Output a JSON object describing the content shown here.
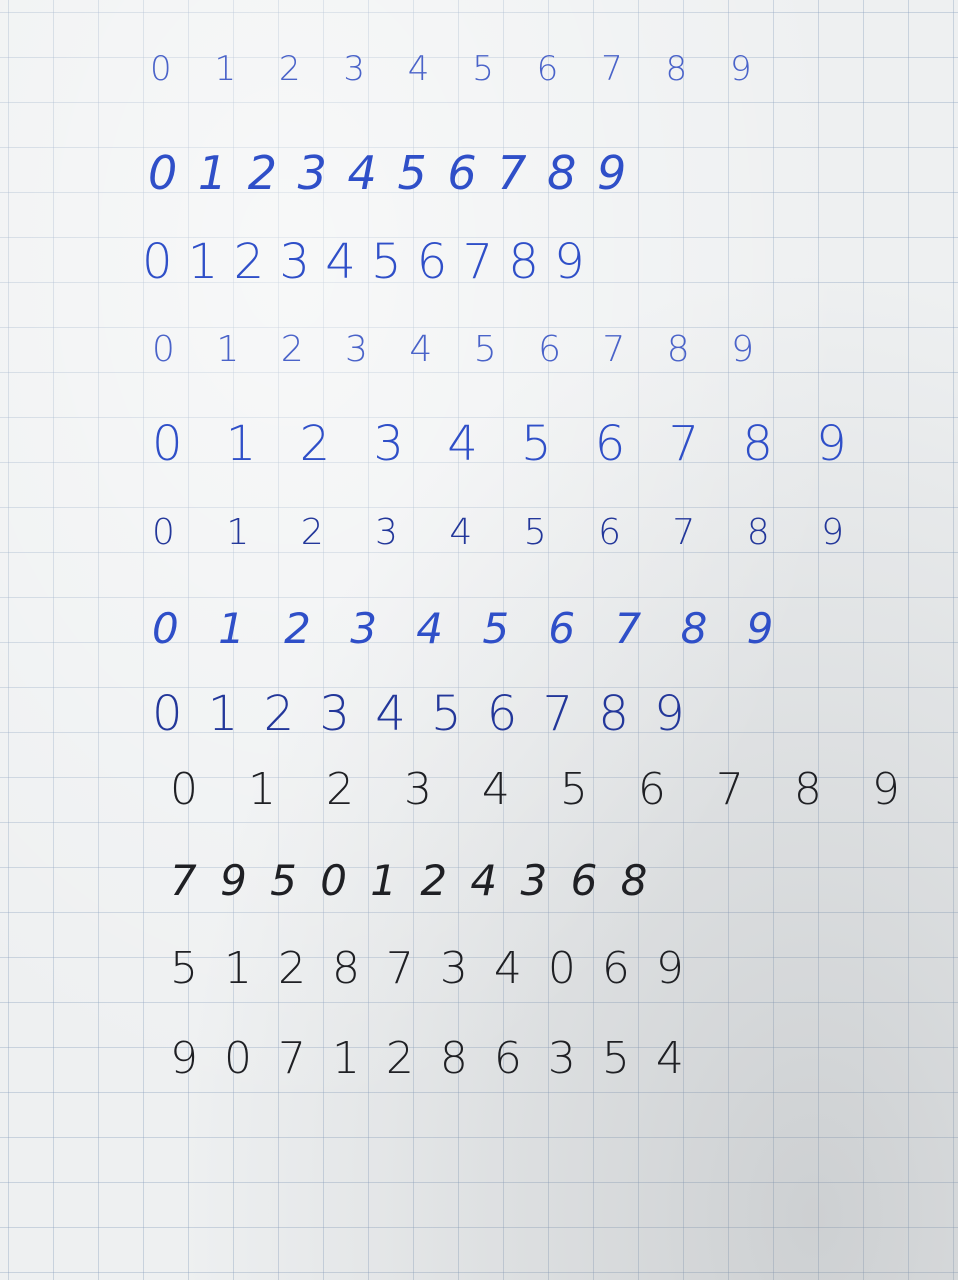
{
  "rows": [
    "0 1 2 3 4 5 6 7 8 9",
    "0 1 2 3 4 5 6 7 8 9",
    "0 1 2 3 4 5 6 7 8 9",
    "0 1 2 3 4 5 6 7 8 9",
    "0 1 2 3 4 5 6 7 8 9",
    "0 1 2 3 4 5 6 7 8 9",
    "0 1 2 3 4 5 6 7 8 9",
    "0 1 2 3 4 5 6 7 8 9",
    "0 1 2 3 4 5 6 7 8 9",
    "7 9 5 0 1 2 4 3 6 8",
    "5 1 2 8 7 3 4 0 6 9",
    "9 0 7 1 2 8 6 3 5 4"
  ],
  "colors": {
    "paper": "#eef0f1",
    "grid": "#8ca0be",
    "ink_blue_light": "#4a63c9",
    "ink_blue": "#2f4fc8",
    "ink_blue_deep": "#23379a",
    "ink_black": "#1f2024"
  }
}
